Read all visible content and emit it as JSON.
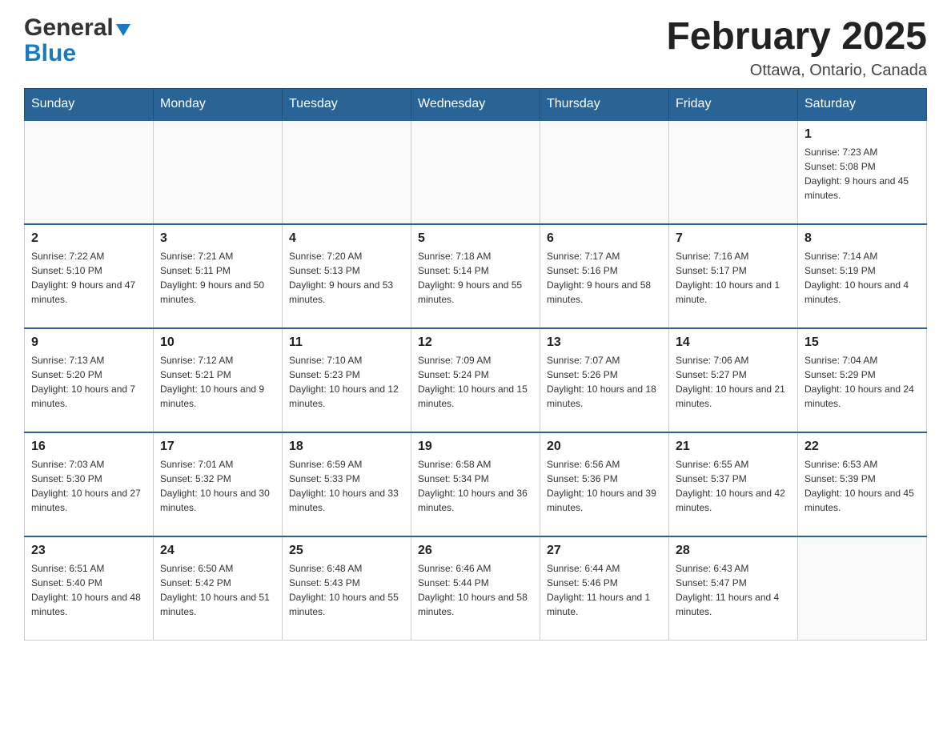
{
  "header": {
    "logo_general": "General",
    "logo_blue": "Blue",
    "month_title": "February 2025",
    "location": "Ottawa, Ontario, Canada"
  },
  "days_of_week": [
    "Sunday",
    "Monday",
    "Tuesday",
    "Wednesday",
    "Thursday",
    "Friday",
    "Saturday"
  ],
  "weeks": [
    [
      {
        "day": "",
        "info": ""
      },
      {
        "day": "",
        "info": ""
      },
      {
        "day": "",
        "info": ""
      },
      {
        "day": "",
        "info": ""
      },
      {
        "day": "",
        "info": ""
      },
      {
        "day": "",
        "info": ""
      },
      {
        "day": "1",
        "info": "Sunrise: 7:23 AM\nSunset: 5:08 PM\nDaylight: 9 hours and 45 minutes."
      }
    ],
    [
      {
        "day": "2",
        "info": "Sunrise: 7:22 AM\nSunset: 5:10 PM\nDaylight: 9 hours and 47 minutes."
      },
      {
        "day": "3",
        "info": "Sunrise: 7:21 AM\nSunset: 5:11 PM\nDaylight: 9 hours and 50 minutes."
      },
      {
        "day": "4",
        "info": "Sunrise: 7:20 AM\nSunset: 5:13 PM\nDaylight: 9 hours and 53 minutes."
      },
      {
        "day": "5",
        "info": "Sunrise: 7:18 AM\nSunset: 5:14 PM\nDaylight: 9 hours and 55 minutes."
      },
      {
        "day": "6",
        "info": "Sunrise: 7:17 AM\nSunset: 5:16 PM\nDaylight: 9 hours and 58 minutes."
      },
      {
        "day": "7",
        "info": "Sunrise: 7:16 AM\nSunset: 5:17 PM\nDaylight: 10 hours and 1 minute."
      },
      {
        "day": "8",
        "info": "Sunrise: 7:14 AM\nSunset: 5:19 PM\nDaylight: 10 hours and 4 minutes."
      }
    ],
    [
      {
        "day": "9",
        "info": "Sunrise: 7:13 AM\nSunset: 5:20 PM\nDaylight: 10 hours and 7 minutes."
      },
      {
        "day": "10",
        "info": "Sunrise: 7:12 AM\nSunset: 5:21 PM\nDaylight: 10 hours and 9 minutes."
      },
      {
        "day": "11",
        "info": "Sunrise: 7:10 AM\nSunset: 5:23 PM\nDaylight: 10 hours and 12 minutes."
      },
      {
        "day": "12",
        "info": "Sunrise: 7:09 AM\nSunset: 5:24 PM\nDaylight: 10 hours and 15 minutes."
      },
      {
        "day": "13",
        "info": "Sunrise: 7:07 AM\nSunset: 5:26 PM\nDaylight: 10 hours and 18 minutes."
      },
      {
        "day": "14",
        "info": "Sunrise: 7:06 AM\nSunset: 5:27 PM\nDaylight: 10 hours and 21 minutes."
      },
      {
        "day": "15",
        "info": "Sunrise: 7:04 AM\nSunset: 5:29 PM\nDaylight: 10 hours and 24 minutes."
      }
    ],
    [
      {
        "day": "16",
        "info": "Sunrise: 7:03 AM\nSunset: 5:30 PM\nDaylight: 10 hours and 27 minutes."
      },
      {
        "day": "17",
        "info": "Sunrise: 7:01 AM\nSunset: 5:32 PM\nDaylight: 10 hours and 30 minutes."
      },
      {
        "day": "18",
        "info": "Sunrise: 6:59 AM\nSunset: 5:33 PM\nDaylight: 10 hours and 33 minutes."
      },
      {
        "day": "19",
        "info": "Sunrise: 6:58 AM\nSunset: 5:34 PM\nDaylight: 10 hours and 36 minutes."
      },
      {
        "day": "20",
        "info": "Sunrise: 6:56 AM\nSunset: 5:36 PM\nDaylight: 10 hours and 39 minutes."
      },
      {
        "day": "21",
        "info": "Sunrise: 6:55 AM\nSunset: 5:37 PM\nDaylight: 10 hours and 42 minutes."
      },
      {
        "day": "22",
        "info": "Sunrise: 6:53 AM\nSunset: 5:39 PM\nDaylight: 10 hours and 45 minutes."
      }
    ],
    [
      {
        "day": "23",
        "info": "Sunrise: 6:51 AM\nSunset: 5:40 PM\nDaylight: 10 hours and 48 minutes."
      },
      {
        "day": "24",
        "info": "Sunrise: 6:50 AM\nSunset: 5:42 PM\nDaylight: 10 hours and 51 minutes."
      },
      {
        "day": "25",
        "info": "Sunrise: 6:48 AM\nSunset: 5:43 PM\nDaylight: 10 hours and 55 minutes."
      },
      {
        "day": "26",
        "info": "Sunrise: 6:46 AM\nSunset: 5:44 PM\nDaylight: 10 hours and 58 minutes."
      },
      {
        "day": "27",
        "info": "Sunrise: 6:44 AM\nSunset: 5:46 PM\nDaylight: 11 hours and 1 minute."
      },
      {
        "day": "28",
        "info": "Sunrise: 6:43 AM\nSunset: 5:47 PM\nDaylight: 11 hours and 4 minutes."
      },
      {
        "day": "",
        "info": ""
      }
    ]
  ]
}
